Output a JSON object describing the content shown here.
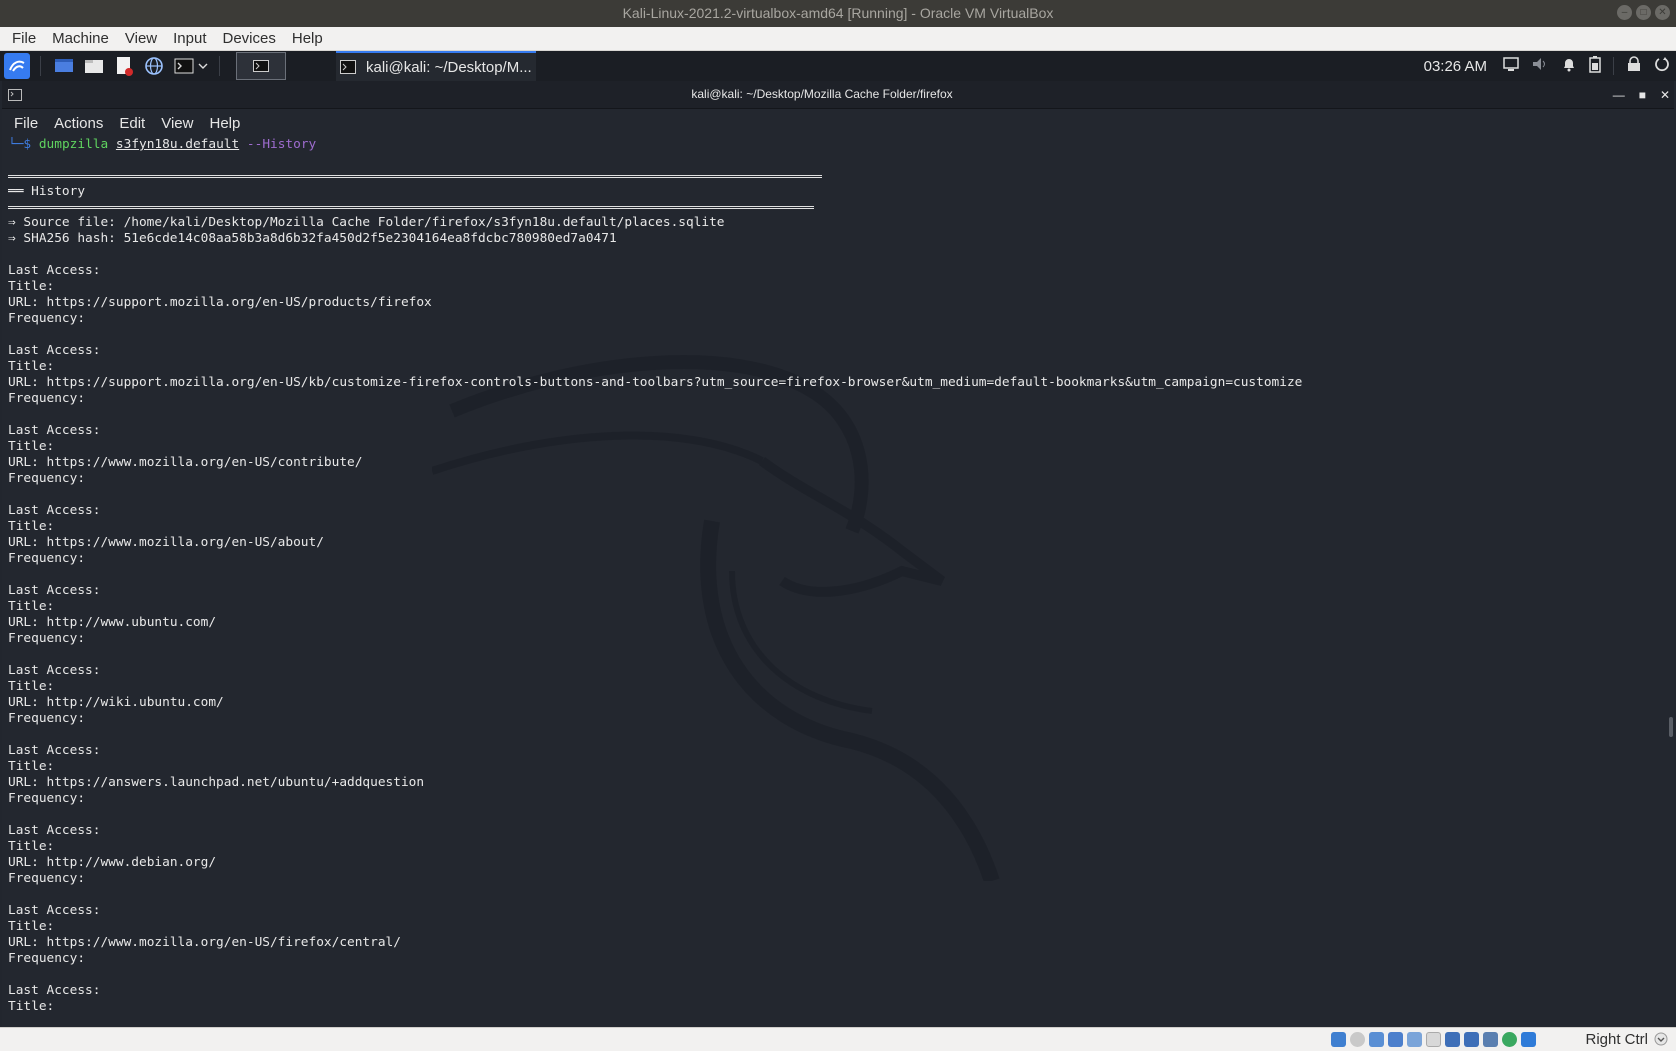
{
  "host": {
    "window_title": "Kali-Linux-2021.2-virtualbox-amd64 [Running] - Oracle VM VirtualBox",
    "menu": [
      "File",
      "Machine",
      "View",
      "Input",
      "Devices",
      "Help"
    ],
    "host_key_label": "Right Ctrl"
  },
  "panel": {
    "task_label": "kali@kali: ~/Desktop/M...",
    "clock": "03:26 AM",
    "icons": [
      "kali-menu-icon",
      "desktop-icon",
      "file-manager-icon",
      "text-editor-icon",
      "browser-icon",
      "terminal-icon",
      "volume-icon",
      "notification-bell-icon",
      "battery-icon",
      "lock-icon",
      "power-icon"
    ],
    "accent": "#367bf0"
  },
  "terminal": {
    "title": "kali@kali: ~/Desktop/Mozilla Cache Folder/firefox",
    "menu": [
      "File",
      "Actions",
      "Edit",
      "View",
      "Help"
    ],
    "prompt_prefix": "└─$",
    "command": "dumpzilla",
    "command_arg": "s3fyn18u.default",
    "command_option": "--History",
    "section_header": "══ History",
    "source_file": "⇒ Source file: /home/kali/Desktop/Mozilla Cache Folder/firefox/s3fyn18u.default/places.sqlite",
    "sha256": "⇒ SHA256 hash: 51e6cde14c08aa58b3a8d6b32fa450d2f5e2304164ea8fdcbc780980ed7a0471",
    "labels": {
      "last_access": "Last Access:",
      "title": "Title:",
      "url": "URL:",
      "frequency": "Frequency:"
    },
    "entries": [
      {
        "url": "https://support.mozilla.org/en-US/products/firefox"
      },
      {
        "url": "https://support.mozilla.org/en-US/kb/customize-firefox-controls-buttons-and-toolbars?utm_source=firefox-browser&utm_medium=default-bookmarks&utm_campaign=customize"
      },
      {
        "url": "https://www.mozilla.org/en-US/contribute/"
      },
      {
        "url": "https://www.mozilla.org/en-US/about/"
      },
      {
        "url": "http://www.ubuntu.com/"
      },
      {
        "url": "http://wiki.ubuntu.com/"
      },
      {
        "url": "https://answers.launchpad.net/ubuntu/+addquestion"
      },
      {
        "url": "http://www.debian.org/"
      },
      {
        "url": "https://www.mozilla.org/en-US/firefox/central/"
      }
    ]
  },
  "status_icons": [
    "hdd-icon",
    "optical-icon",
    "audio-icon",
    "network-icon",
    "usb-icon",
    "shared-folder-icon",
    "display-icon",
    "video-capture-icon",
    "cpu-icon",
    "mouse-integration-icon",
    "host-key-icon"
  ]
}
